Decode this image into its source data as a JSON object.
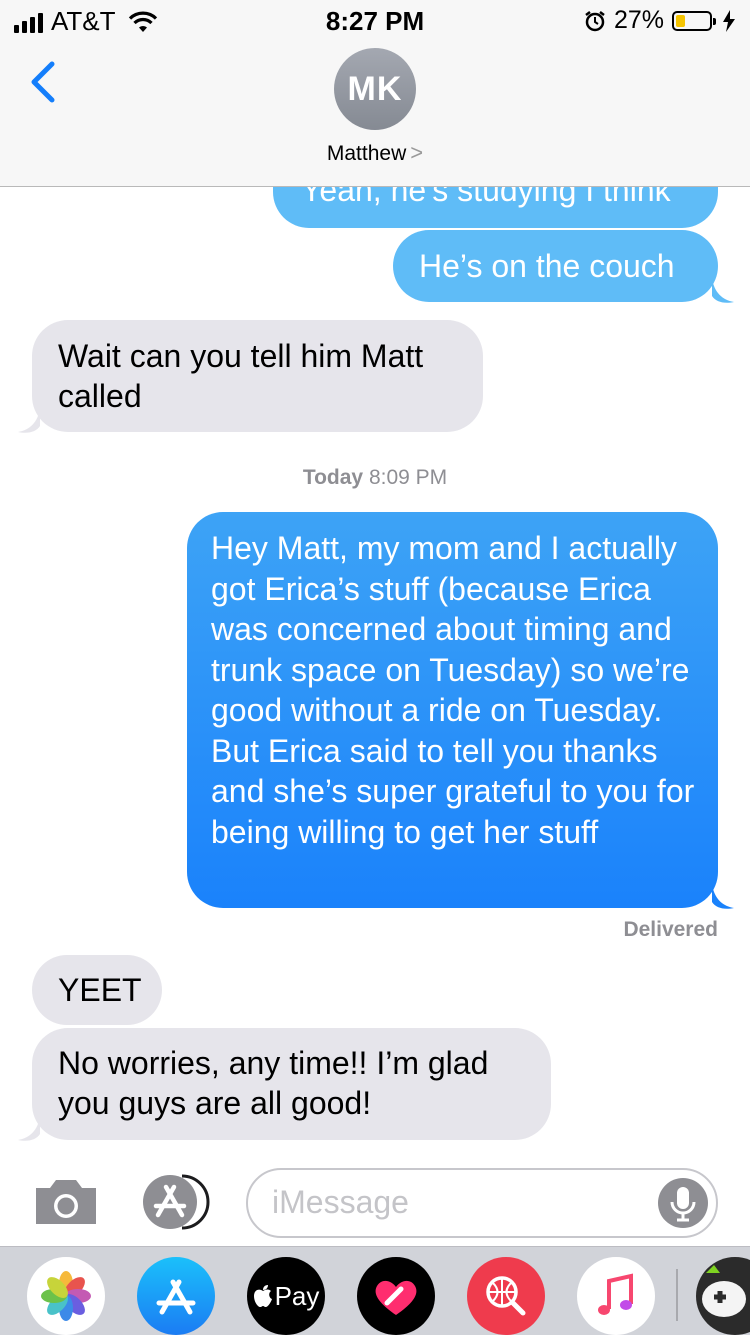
{
  "status_bar": {
    "carrier": "AT&T",
    "time": "8:27 PM",
    "battery_percent": "27%",
    "signal_bars": 4,
    "battery_level": 0.27,
    "icons": [
      "signal-bars-icon",
      "wifi-icon",
      "alarm-icon",
      "battery-icon",
      "charging-bolt-icon"
    ]
  },
  "header": {
    "back_icon": "chevron-left-icon",
    "avatar_initials": "MK",
    "contact_name": "Matthew",
    "contact_chevron": ">"
  },
  "messages": [
    {
      "side": "out",
      "text": "Yeah, he's studying I think"
    },
    {
      "side": "out",
      "text": "He’s on the couch"
    },
    {
      "side": "in",
      "text": "Wait can you tell him Matt called"
    },
    {
      "side": "out",
      "text": "Hey Matt, my mom and I actually got Erica’s stuff (because Erica was concerned about timing and trunk space on Tuesday) so we’re good without a ride on Tuesday. But Erica said to tell you thanks and she’s super grateful to you for being willing to get her stuff"
    },
    {
      "side": "in",
      "text": "YEET"
    },
    {
      "side": "in",
      "text": "No worries, any time!! I’m glad you guys are all good!"
    }
  ],
  "timestamp": {
    "day": "Today",
    "time": "8:09 PM"
  },
  "delivery_status": "Delivered",
  "input": {
    "placeholder": "iMessage",
    "icons": [
      "camera-icon",
      "app-store-icon",
      "microphone-icon"
    ]
  },
  "app_drawer": {
    "apple_pay_label": "Pay",
    "apps": [
      "photos-icon",
      "app-store-icon",
      "apple-pay-icon",
      "digital-touch-icon",
      "web-search-icon",
      "music-icon",
      "game-app-icon"
    ]
  },
  "colors": {
    "sent_bubble": "#5fbcf7",
    "sent_bubble_active": "#1a82fb",
    "received_bubble": "#e6e5eb",
    "ios_blue": "#147efb"
  }
}
